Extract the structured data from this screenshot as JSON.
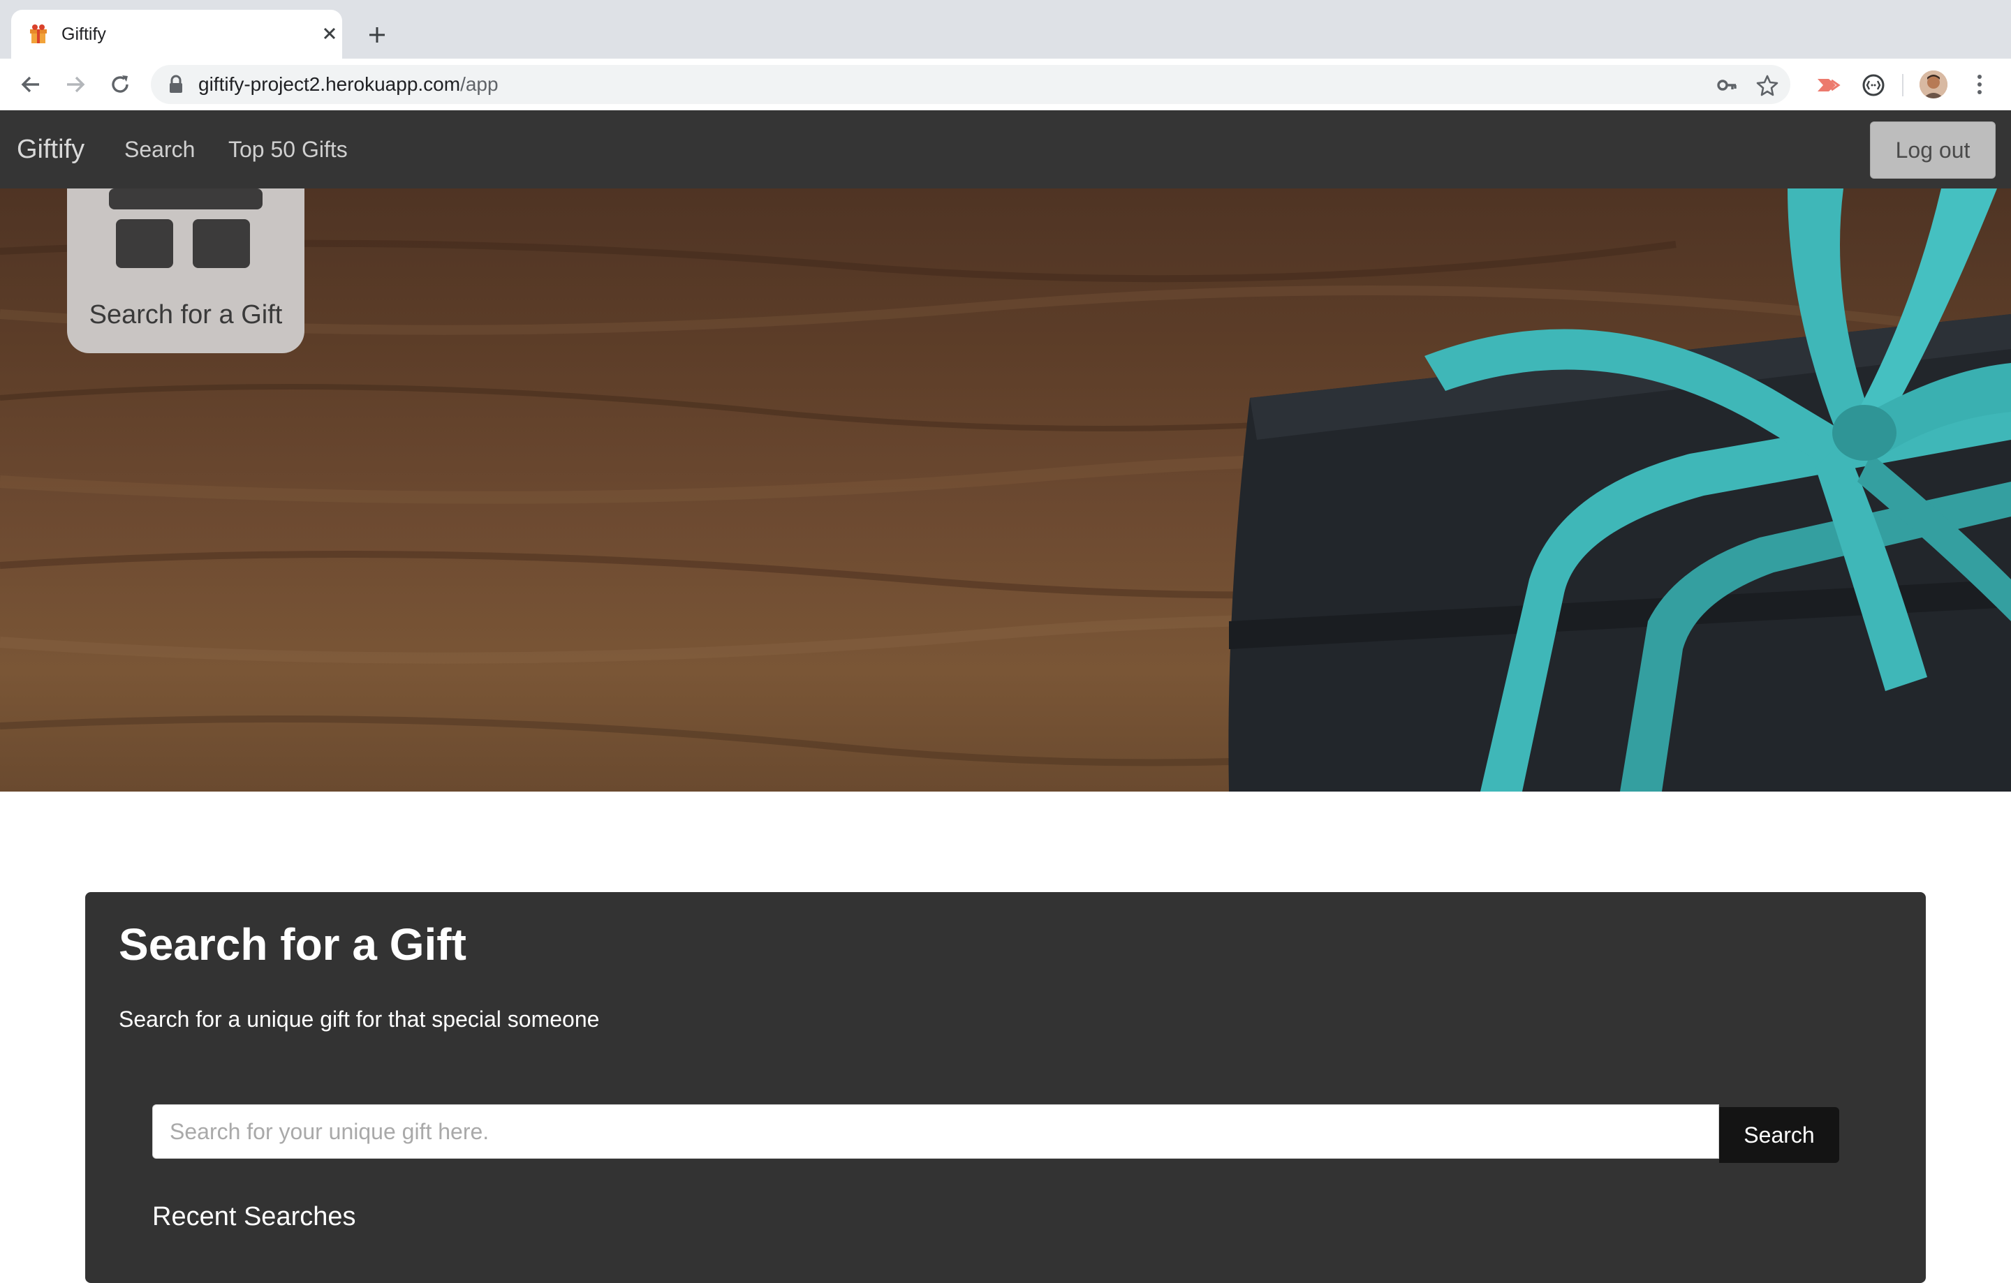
{
  "browser": {
    "tab_title": "Giftify",
    "url_host": "giftify-project2.herokuapp.com",
    "url_path": "/app",
    "icons": [
      "back-icon",
      "forward-icon",
      "reload-icon",
      "lock-icon",
      "key-icon",
      "star-icon",
      "extension-icon",
      "extension-icon",
      "avatar",
      "menu-icon",
      "close-icon",
      "new-tab-icon"
    ]
  },
  "navbar": {
    "brand": "Giftify",
    "links": [
      "Search",
      "Top 50 Gifts"
    ],
    "logout": "Log out"
  },
  "hero": {
    "tile_label": "Search for a Gift"
  },
  "search_panel": {
    "title": "Search for a Gift",
    "subtitle": "Search for a unique gift for that special someone",
    "input_placeholder": "Search for your unique gift here.",
    "button": "Search",
    "recent_heading": "Recent Searches"
  },
  "colors": {
    "navbar": "#353535",
    "panel": "#333333",
    "ribbon": "#3fb7b8",
    "box": "#22262b"
  }
}
